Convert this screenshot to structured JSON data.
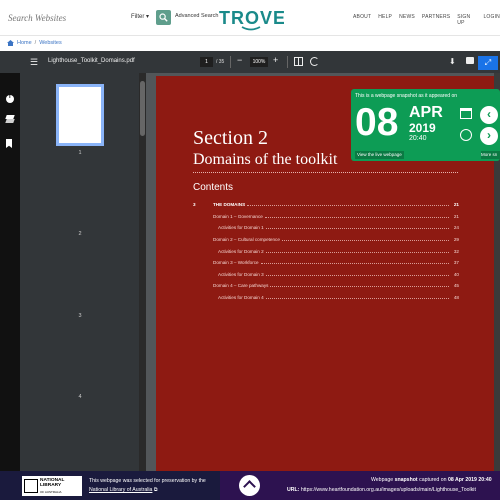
{
  "header": {
    "search_placeholder": "Search Websites",
    "filter_label": "Filter ▾",
    "advanced_label": "Advanced Search",
    "logo_text": "TROVE",
    "nav": [
      "ABOUT",
      "HELP",
      "NEWS",
      "PARTNERS",
      "SIGN UP",
      "LOGIN"
    ]
  },
  "breadcrumb": {
    "home": "Home",
    "sep": "/",
    "current": "Websites"
  },
  "viewer": {
    "doc_title": "Lighthouse_Toolkit_Domains.pdf",
    "page_current": "1",
    "page_total": "/ 35",
    "zoom": "100%",
    "thumb_numbers": [
      "1",
      "2",
      "3",
      "4"
    ]
  },
  "document": {
    "section": "Section 2",
    "title": "Domains of the toolkit",
    "contents_heading": "Contents",
    "toc": [
      {
        "num": "3",
        "label": "THE DOMAINS",
        "page": "21",
        "bold": true,
        "indent": 0
      },
      {
        "num": "",
        "label": "Domain 1 – Governance",
        "page": "21",
        "bold": false,
        "indent": 0
      },
      {
        "num": "",
        "label": "Activities for Domain 1",
        "page": "24",
        "bold": false,
        "indent": 1
      },
      {
        "num": "",
        "label": "Domain 2 – Cultural competence",
        "page": "29",
        "bold": false,
        "indent": 0
      },
      {
        "num": "",
        "label": "Activities for Domain 2",
        "page": "32",
        "bold": false,
        "indent": 1
      },
      {
        "num": "",
        "label": "Domain 3 – Workforce",
        "page": "37",
        "bold": false,
        "indent": 0
      },
      {
        "num": "",
        "label": "Activities for Domain 3",
        "page": "40",
        "bold": false,
        "indent": 1
      },
      {
        "num": "",
        "label": "Domain 4 – Care pathways",
        "page": "45",
        "bold": false,
        "indent": 0
      },
      {
        "num": "",
        "label": "Activities for Domain 4",
        "page": "48",
        "bold": false,
        "indent": 1
      }
    ]
  },
  "snapshot": {
    "note": "This is a webpage snapshot as it appeared on",
    "day": "08",
    "month": "APR",
    "year": "2019",
    "time": "20:40",
    "live_label": "View the live webpage",
    "more_label": "More sn",
    "prev_glyph": "‹",
    "next_glyph": "›"
  },
  "footer": {
    "nla_line1": "NATIONAL",
    "nla_line2": "LIBRARY",
    "nla_line3": "OF AUSTRALIA",
    "message": "This webpage was selected for preservation by the",
    "link": "National Library of Australia",
    "caption_pre": "Webpage",
    "caption_bold": "snapshot",
    "caption_mid": "captured on",
    "caption_date": "08 Apr 2019 20:40",
    "url_label": "URL:",
    "url": "https://www.heartfoundation.org.au/images/uploads/main/Lighthouse_Toolkit"
  },
  "colors": {
    "trove_teal": "#1a8a8a",
    "page_red": "#8e1a12",
    "snapshot_green": "#0d9c55",
    "footer_purple": "#2d1250"
  }
}
